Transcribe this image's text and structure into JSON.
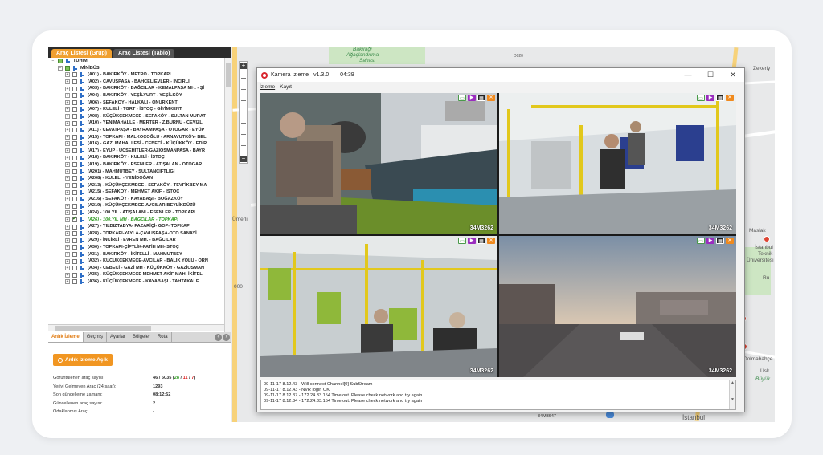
{
  "left_panel": {
    "tabs": [
      "Araç Listesi (Grup)",
      "Araç Listesi (Tablo)"
    ],
    "tree": {
      "root": "TUHIM",
      "group": "MİNİBÜS",
      "items": [
        "(A01) - BAKIRKÖY - METRO - TOPKAPI",
        "(A02) - ÇAVUŞPAŞA - BAHÇELİEVLER - İNCİRLİ",
        "(A03) - BAKIRKÖY - BAĞCILAR - KEMALPAŞA MH. - Şİ",
        "(A04) - BAKIRKÖY - YEŞİLYURT - YEŞİLKÖY",
        "(A06) - SEFAKÖY - HALKALI - ONURKENT",
        "(A07) - KULELİ - TGRT - İSTOÇ - GİYİMKENT",
        "(A08) - KÜÇÜKÇEKMECE - SEFAKÖY - SULTAN MURAT",
        "(A10) - YENİMAHALLE - MERTER - Z.BURNU - CEVİZL",
        "(A11) - CEVATPAŞA - BAYRAMPAŞA - OTOGAR - EYÜP",
        "(A15) - TOPKAPI - MALKOÇOĞLU - ARNAVUTKÖY- BEL",
        "(A16) - GAZİ MAHALLESİ - CEBECİ - KÜÇÜKKÖY - EDİR",
        "(A17) - EYÜP - ÜÇŞEHİTLER-GAZİOSMANPAŞA - BAYR",
        "(A18) - BAKIRKÖY - KULELİ - İSTOÇ",
        "(A19) - BAKIRKÖY - ESENLER - ATIŞALAN - OTOGAR",
        "(A201) - MAHMUTBEY - SULTANÇİFTLİĞİ",
        "(A208) - KULELİ - YENİDOĞAN",
        "(A213) - KÜÇÜKÇEKMECE - SEFAKÖY - TEVFİKBEY MA",
        "(A215) - SEFAKÖY - MEHMET AKİF - İSTOÇ",
        "(A216) - SEFAKÖY - KAYABAŞI - BOĞAZKÖY",
        "(A219) - KÜÇÜKÇEKMECE-AVCILAR-BEYLİKDÜZÜ",
        "(A24) - 100.YIL - ATIŞALANI - ESENLER - TOPKAPI",
        "(A26) - 100.YIL MH - BAĞCILAR - TOPKAPI",
        "(A27) - YILDIZTABYA- PAZARİÇİ- GOP- TOPKAPI",
        "(A28) - TOPKAPI-YAYLA-ÇAVUŞPAŞA-OTO SANAYİ",
        "(A29) - İNCİRLİ - EVREN MH. - BAĞCILAR",
        "(A30) - TOPKAPI-ÇİFTLİK-FATİH MH-İSTOÇ",
        "(A31) - BAKIRKÖY - İKİTELLİ - MAHMUTBEY",
        "(A32) - KÜÇÜKÇEKMECE-AVCILAR - BALIK YOLU - ÖRN",
        "(A34) - CEBECİ - GAZİ MH - KÜÇÜKKÖY - GAZİOSMAN",
        "(A35) - KÜÇÜKÇEKMECE MEHMET AKİF MAH- İKİTEL",
        "(A36) - KÜÇÜKÇEKMECE - KAYABAŞI - TAHTAKALE"
      ]
    },
    "bottom_tabs": [
      "Anlık İzleme",
      "Geçmiş",
      "Ayarlar",
      "Bölgeler",
      "Rota"
    ],
    "live_button": "Anlık İzleme Açık",
    "stats": [
      {
        "label": "Görüntülenen araç sayısı:",
        "v1": "46 / 5035",
        "v2": " (",
        "v3": "28",
        "v4": " / ",
        "v5": "11",
        "v6": " / ",
        "v7": "7",
        "v8": ")"
      },
      {
        "label": "Yeriyi Gelmeyen Araç (24 saat):",
        "v1": "1293"
      },
      {
        "label": "Son güncelleme zamanı:",
        "v1": "08:12:52"
      },
      {
        "label": "Güncellenen araç sayısı:",
        "v1": "2"
      },
      {
        "label": "Odaklanmış Araç",
        "v1": "-"
      }
    ]
  },
  "map": {
    "labels": [
      "Bakırlığı",
      "Ağaçlandırma",
      "Sahası",
      "Zekeriy",
      "Ümerli",
      "Maslak",
      "İstanbul",
      "Teknik",
      "Üniversitesi",
      "Ru",
      "Dolmabahçe",
      "Üsk",
      "Büyük",
      "İstanbul",
      "34M3647",
      "000",
      "D020"
    ]
  },
  "camera_window": {
    "title": "Kamera İzleme",
    "version": "v1.3.0",
    "time": "04:39",
    "menu": [
      "İzleme",
      "Kayıt"
    ],
    "plates": [
      "34M3262",
      "34M3262",
      "34M3262",
      "34M3262"
    ],
    "log": [
      "09-11-17 8.12.43 - Will connect Channel[0] SubStream",
      "09-11-17 8.12.43 - NVR login OK",
      "09-11-17 8.12.37 - 172.24.33.154 Time out. Please check network and try again",
      "09-11-17 8.12.34 - 172.24.33.154 Time out. Please check network and try again"
    ]
  },
  "colors": {
    "accent": "#f0a030",
    "selection_green": "#2d9a20",
    "window_red": "#d8262e",
    "grab_handle_blue": "#3ea0e0"
  }
}
